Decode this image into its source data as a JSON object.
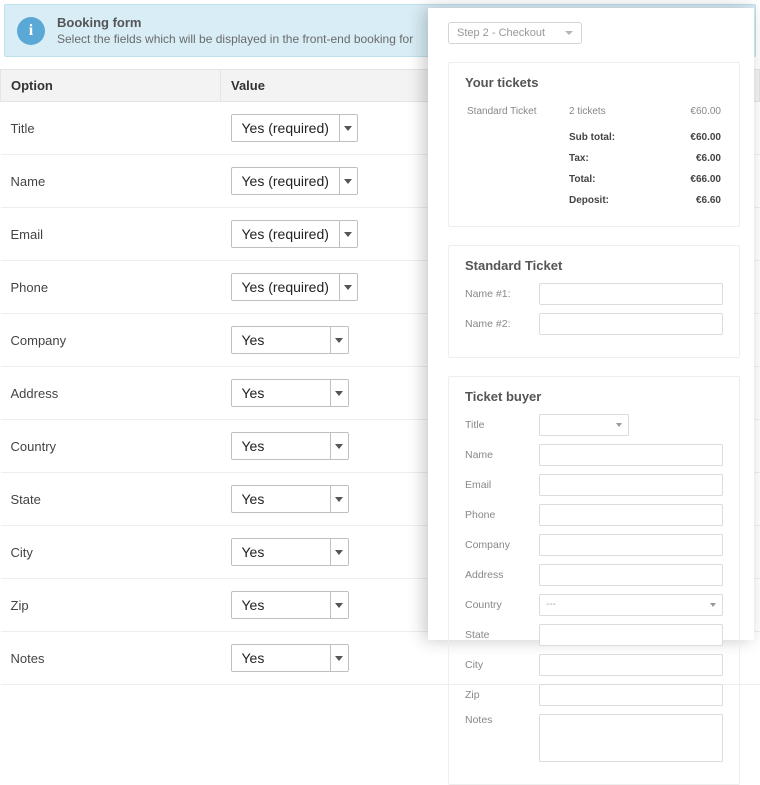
{
  "banner": {
    "title": "Booking form",
    "desc": "Select the fields which will be displayed in the front-end booking for"
  },
  "table": {
    "headers": {
      "option": "Option",
      "value": "Value"
    },
    "rows": [
      {
        "label": "Title",
        "value": "Yes (required)"
      },
      {
        "label": "Name",
        "value": "Yes (required)"
      },
      {
        "label": "Email",
        "value": "Yes (required)"
      },
      {
        "label": "Phone",
        "value": "Yes (required)"
      },
      {
        "label": "Company",
        "value": "Yes"
      },
      {
        "label": "Address",
        "value": "Yes"
      },
      {
        "label": "Country",
        "value": "Yes"
      },
      {
        "label": "State",
        "value": "Yes"
      },
      {
        "label": "City",
        "value": "Yes"
      },
      {
        "label": "Zip",
        "value": "Yes"
      },
      {
        "label": "Notes",
        "value": "Yes"
      }
    ]
  },
  "preview": {
    "step_label": "Step 2 - Checkout",
    "tickets": {
      "heading": "Your tickets",
      "item_name": "Standard Ticket",
      "item_qty": "2 tickets",
      "item_total": "€60.00",
      "subtotal_label": "Sub total:",
      "subtotal": "€60.00",
      "tax_label": "Tax:",
      "tax": "€6.00",
      "total_label": "Total:",
      "total": "€66.00",
      "deposit_label": "Deposit:",
      "deposit": "€6.60"
    },
    "standard_ticket": {
      "heading": "Standard Ticket",
      "name1": "Name #1:",
      "name2": "Name #2:"
    },
    "buyer": {
      "heading": "Ticket buyer",
      "title": "Title",
      "name": "Name",
      "email": "Email",
      "phone": "Phone",
      "company": "Company",
      "address": "Address",
      "country": "Country",
      "country_value": "---",
      "state": "State",
      "city": "City",
      "zip": "Zip",
      "notes": "Notes"
    }
  }
}
